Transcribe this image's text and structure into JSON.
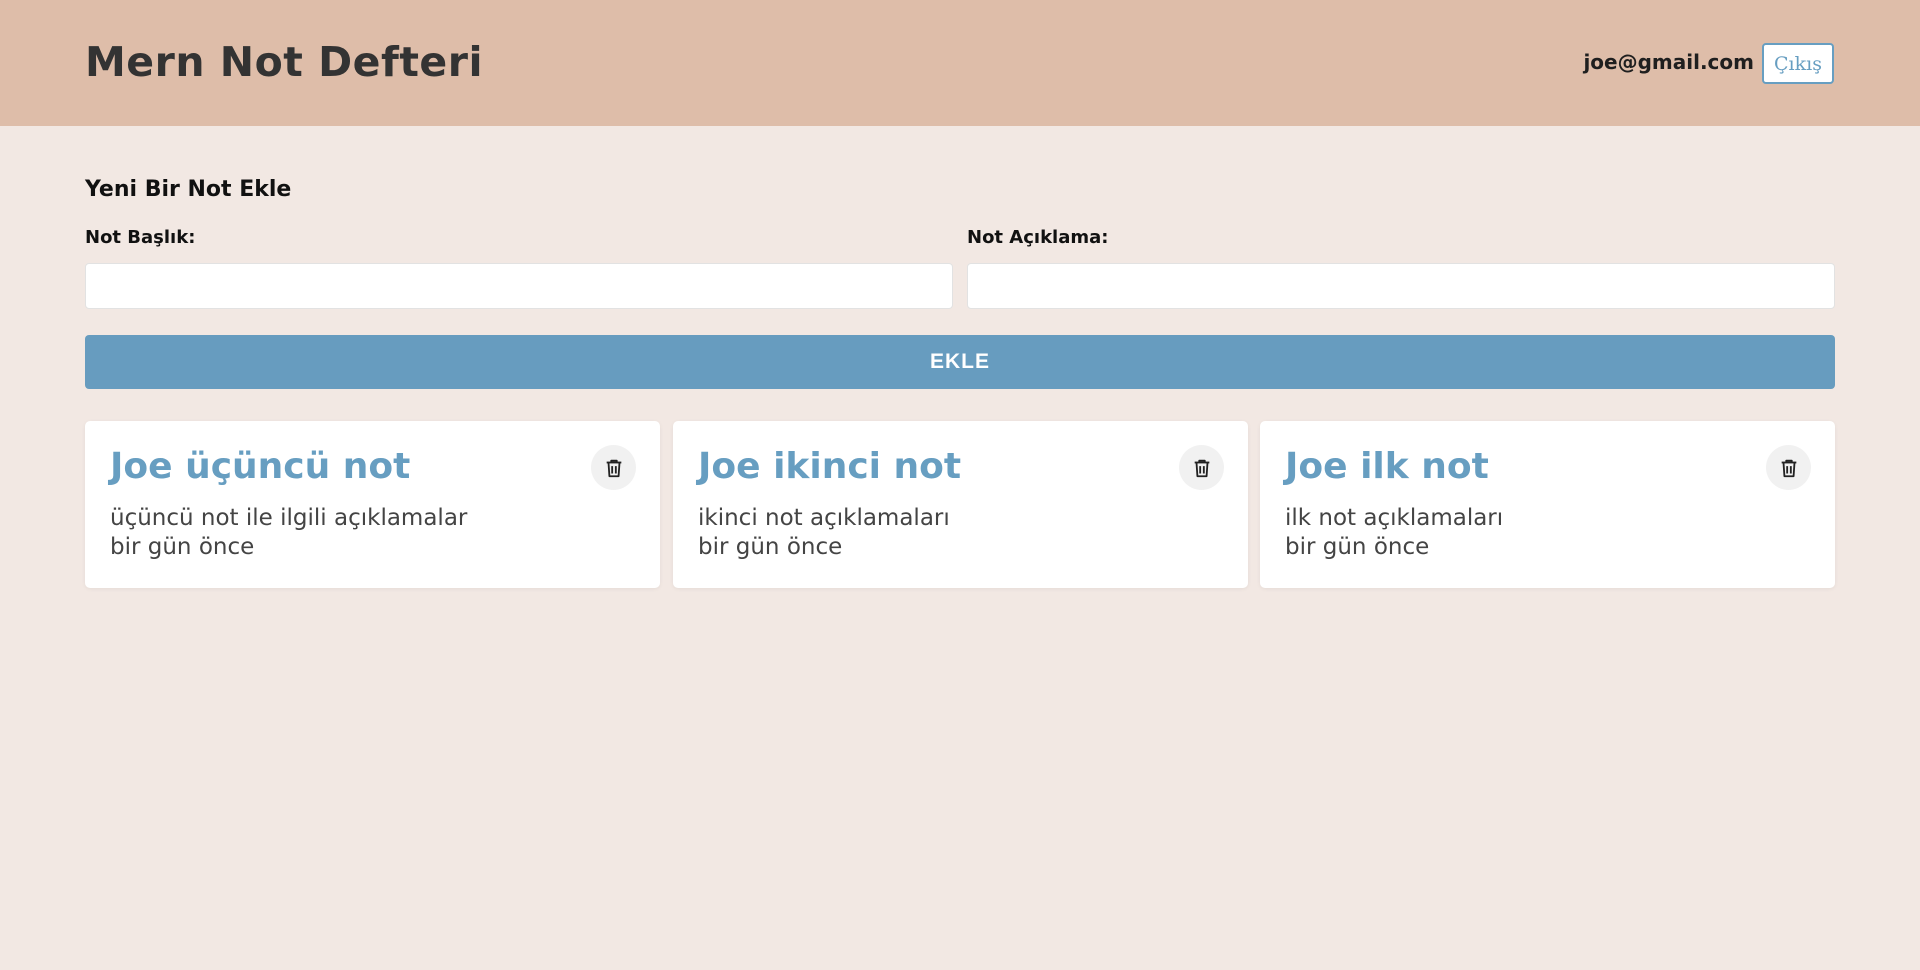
{
  "header": {
    "title": "Mern Not Defteri",
    "user_email": "joe@gmail.com",
    "logout_label": "Çıkış"
  },
  "form": {
    "title": "Yeni Bir Not Ekle",
    "title_label": "Not Başlık:",
    "title_value": "",
    "desc_label": "Not Açıklama:",
    "desc_value": "",
    "submit_label": "EKLE"
  },
  "notes": [
    {
      "title": "Joe üçüncü not",
      "description": "üçüncü not ile ilgili açıklamalar",
      "time": "bir gün önce",
      "delete_icon": "trash-icon"
    },
    {
      "title": "Joe ikinci not",
      "description": "ikinci not açıklamaları",
      "time": "bir gün önce",
      "delete_icon": "trash-icon"
    },
    {
      "title": "Joe ilk not",
      "description": "ilk not açıklamaları",
      "time": "bir gün önce",
      "delete_icon": "trash-icon"
    }
  ],
  "colors": {
    "header_bg": "#debda9",
    "page_bg": "#f2e8e3",
    "accent": "#679cbf",
    "card_bg": "#ffffff"
  }
}
